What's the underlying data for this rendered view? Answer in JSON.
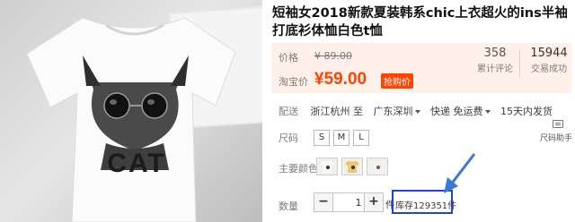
{
  "product": {
    "title": "短袖女2018新款夏装韩系chic上衣超火的ins半袖打底衫体恤白色t恤",
    "image_text": "CAT"
  },
  "price": {
    "original_label": "价格",
    "original_value": "¥ 89.00",
    "taobao_label": "淘宝价",
    "taobao_value": "¥59.00",
    "tag": "抢购价"
  },
  "stats": {
    "reviews_count": "358",
    "reviews_label": "累计评论",
    "sales_count": "15944",
    "sales_label": "交易成功"
  },
  "delivery": {
    "label": "配送",
    "from": "浙江杭州 至",
    "to": "广东深圳",
    "shipping": "快递 免运费",
    "time": "15天内发货"
  },
  "size_chart": {
    "label": "尺码助手"
  },
  "size": {
    "label": "尺码",
    "options": [
      "S",
      "M",
      "L"
    ]
  },
  "color": {
    "label": "主要颜色",
    "options": [
      "white-cat-print",
      "yellow-print",
      "white-brown-print"
    ]
  },
  "quantity": {
    "label": "数量",
    "minus": "−",
    "plus": "+",
    "value": "1",
    "unit": "件",
    "stock": "库存129351件"
  },
  "colors": {
    "accent": "#ff4400",
    "price_bg": "#fff0ea",
    "highlight_box": "#1d48c8"
  }
}
